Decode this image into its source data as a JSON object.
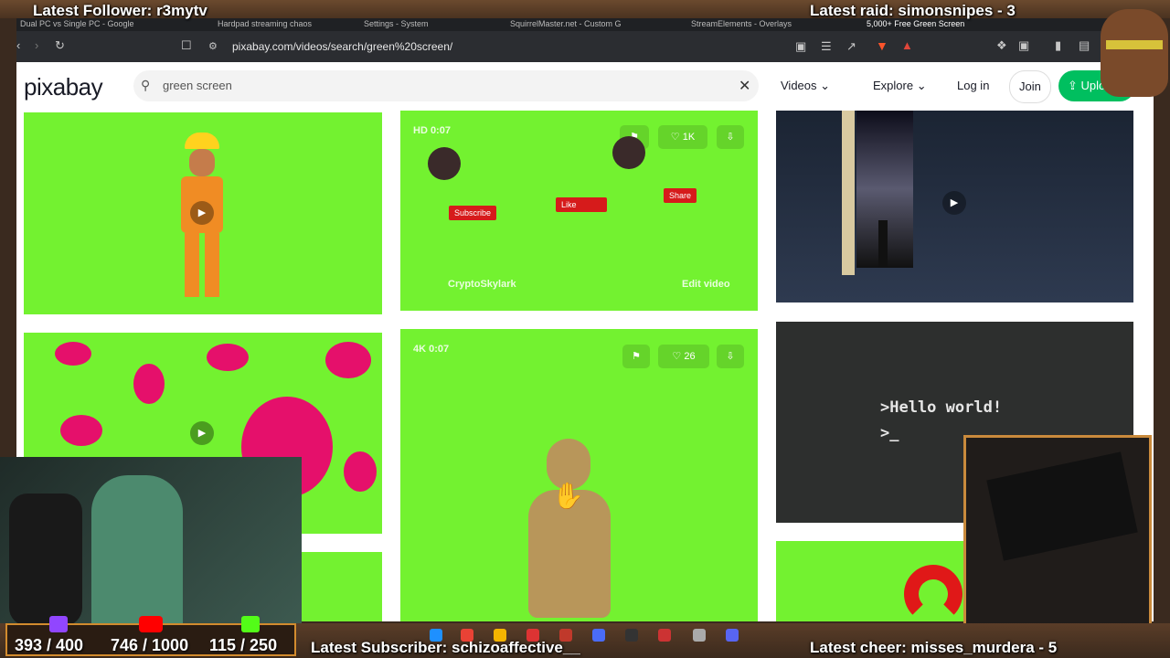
{
  "overlay": {
    "latest_follower": "Latest Follower: r3mytv",
    "latest_raid": "Latest raid: simonsnipes - 3",
    "latest_subscriber": "Latest Subscriber: schizoaffective__",
    "latest_cheer": "Latest cheer: misses_murdera - 5",
    "counters": [
      {
        "icon": "twitch-icon",
        "value": "393 / 400"
      },
      {
        "icon": "youtube-icon",
        "value": "746 / 1000"
      },
      {
        "icon": "kick-icon",
        "value": "115 / 250"
      }
    ]
  },
  "browser": {
    "tabs": [
      "Dual PC vs Single PC - Google",
      "Hardpad streaming chaos",
      "Settings - System",
      "SquirrelMaster.net - Custom G",
      "StreamElements - Overlays",
      "5,000+ Free Green Screen"
    ],
    "url": "pixabay.com/videos/search/green%20screen/"
  },
  "site": {
    "logo": "pixabay",
    "search_value": "green screen",
    "media_type": "Videos",
    "explore": "Explore",
    "login": "Log in",
    "join": "Join",
    "upload": "Upload"
  },
  "cards": {
    "ninja": {
      "meta": "HD 0:07",
      "likes": "1K",
      "subscribe": "Subscribe",
      "like": "Like",
      "share": "Share",
      "author": "CryptoSkylark",
      "edit": "Edit video"
    },
    "statue": {
      "meta": "4K 0:07",
      "likes": "26"
    },
    "terminal": {
      "line1": ">Hello world!",
      "line2": ">_"
    }
  },
  "colors": {
    "green_screen": "#73f230",
    "upload": "#00bf5f",
    "frame": "#3a2a1f"
  }
}
